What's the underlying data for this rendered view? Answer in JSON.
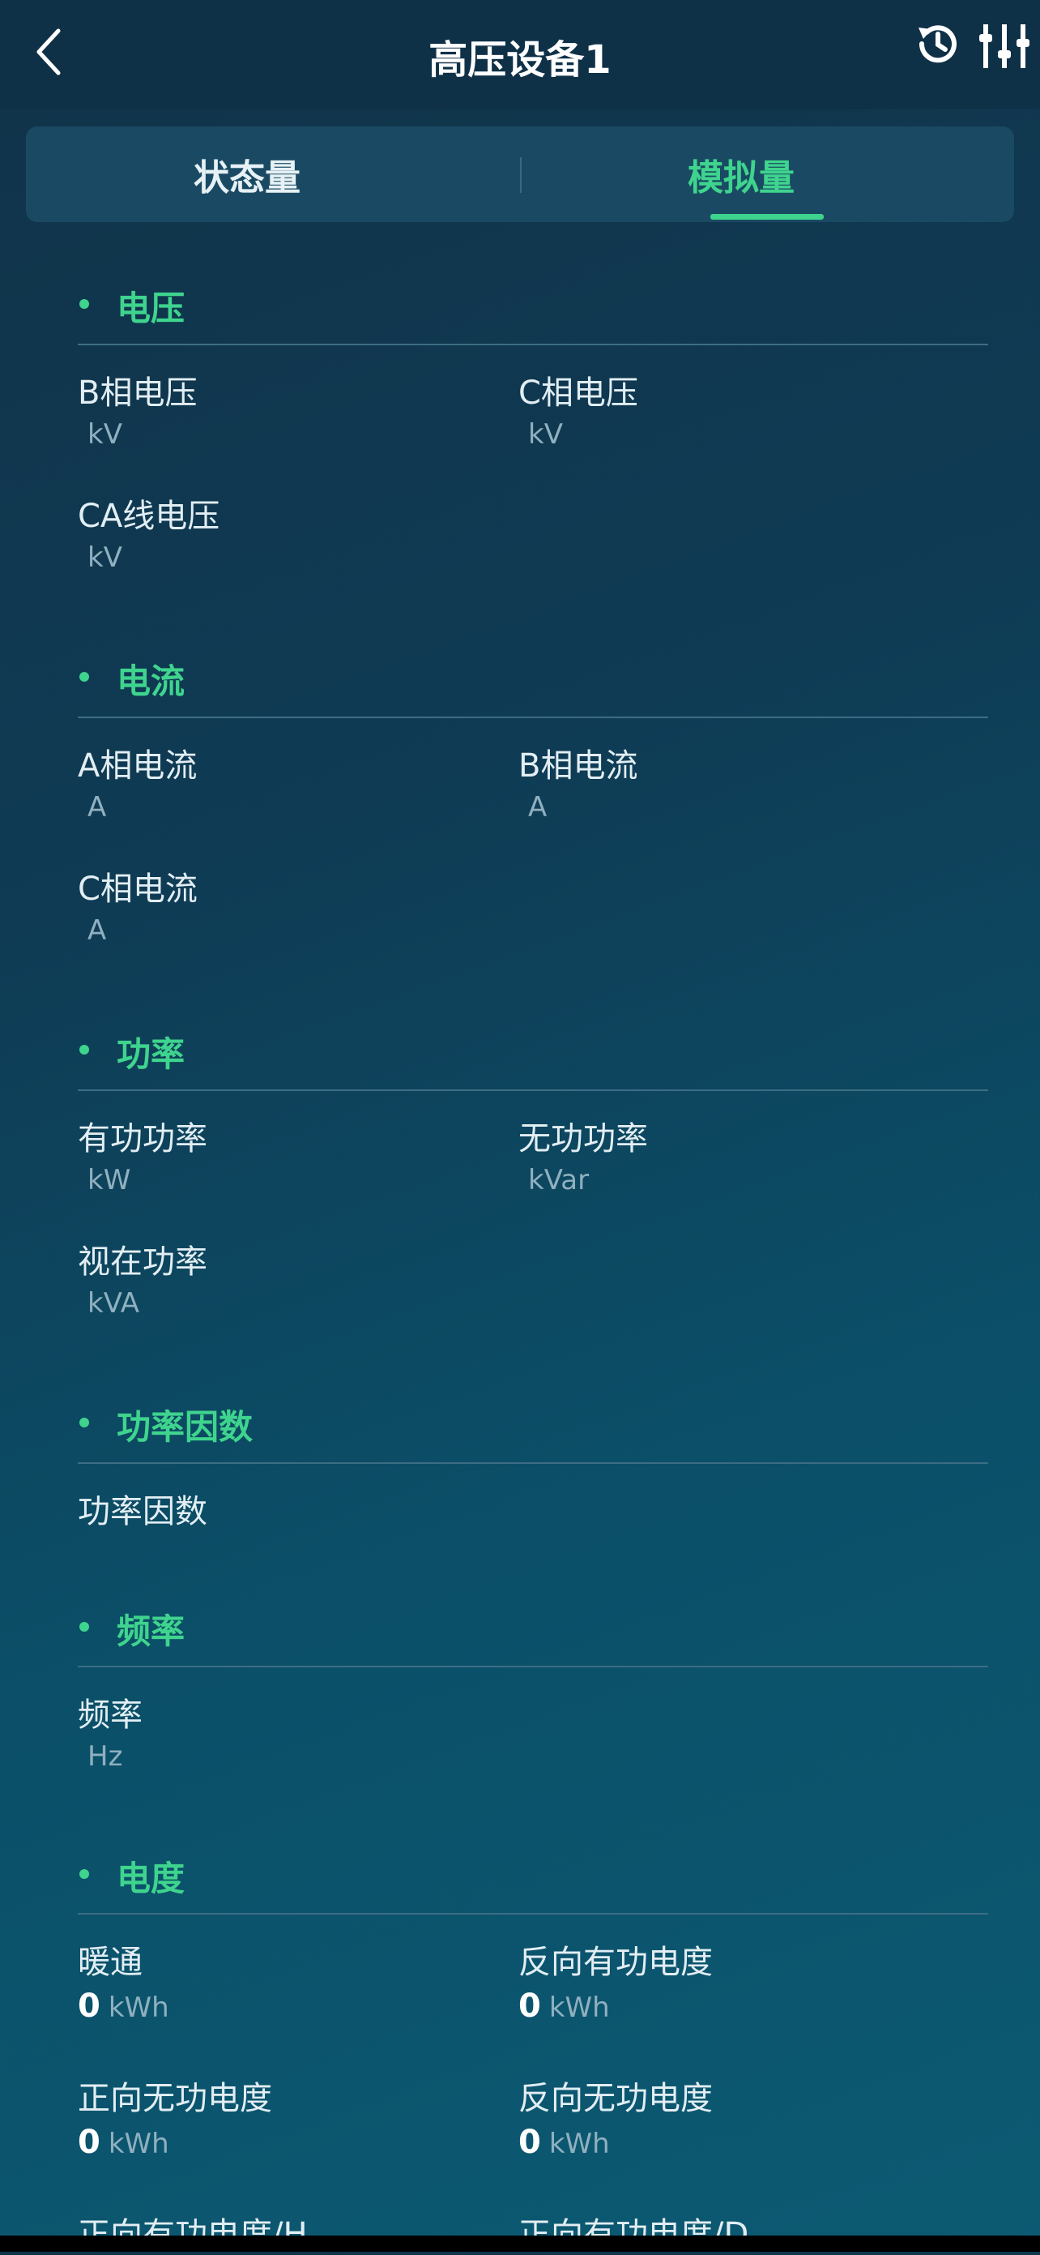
{
  "header": {
    "title": "高压设备1",
    "back_icon": "chevron-left-icon",
    "history_icon": "history-clock-icon",
    "settings_icon": "sliders-icon"
  },
  "tabs": [
    {
      "label": "状态量",
      "active": false
    },
    {
      "label": "模拟量",
      "active": true
    }
  ],
  "accent_color": "#3fd48e",
  "sections": {
    "voltage": {
      "title": "电压",
      "items": [
        {
          "label": "B相电压",
          "unit": "kV"
        },
        {
          "label": "C相电压",
          "unit": "kV"
        },
        {
          "label": "CA线电压",
          "unit": "kV"
        }
      ]
    },
    "current": {
      "title": "电流",
      "items": [
        {
          "label": "A相电流",
          "unit": "A"
        },
        {
          "label": "B相电流",
          "unit": "A"
        },
        {
          "label": "C相电流",
          "unit": "A"
        }
      ]
    },
    "power": {
      "title": "功率",
      "items": [
        {
          "label": "有功功率",
          "unit": "kW"
        },
        {
          "label": "无功功率",
          "unit": "kVar"
        },
        {
          "label": "视在功率",
          "unit": "kVA"
        }
      ]
    },
    "power_factor": {
      "title": "功率因数",
      "items": [
        {
          "label": "功率因数"
        }
      ]
    },
    "frequency": {
      "title": "频率",
      "items": [
        {
          "label": "频率",
          "unit": "Hz"
        }
      ]
    },
    "energy": {
      "title": "电度",
      "items": [
        {
          "label": "暖通",
          "value": "0",
          "unit": "kWh"
        },
        {
          "label": "反向有功电度",
          "value": "0",
          "unit": "kWh"
        },
        {
          "label": "正向无功电度",
          "value": "0",
          "unit": "kWh"
        },
        {
          "label": "反向无功电度",
          "value": "0",
          "unit": "kWh"
        },
        {
          "label": "正向有功电度/H"
        },
        {
          "label": "正向有功电度/D"
        }
      ]
    }
  }
}
